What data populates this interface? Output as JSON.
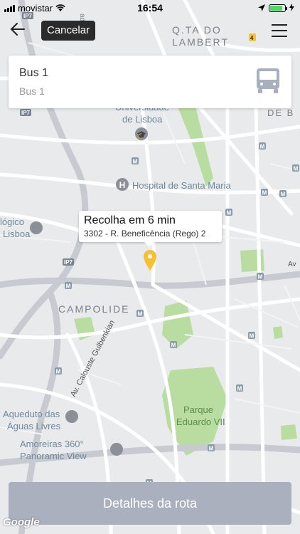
{
  "status": {
    "carrier": "movistar",
    "time": "16:54",
    "battery_fill": 0.85,
    "battery_color": "#4cd964"
  },
  "toolbar": {
    "back_icon": "arrow-left-icon",
    "cancel_label": "Cancelar",
    "menu_icon": "hamburger-menu-icon"
  },
  "bus_card": {
    "title": "Bus 1",
    "subtitle": "Bus 1",
    "icon": "bus-icon"
  },
  "pickup": {
    "title": "Recolha em 6 min",
    "address": "3302 - R. Beneficência (Rego) 2",
    "pin_color": "#f6c131"
  },
  "map": {
    "labels": {
      "qta_lambert_1": "Q.TA DO",
      "qta_lambert_2": "LAMBERT",
      "universidade_1": "Universidade",
      "universidade_2": "de Lisboa",
      "hospital": "Hospital de Santa Maria",
      "logico_1": "lógico",
      "logico_2": "Lisboa",
      "campolide": "CAMPOLIDE",
      "av_calouste": "Av. Calouste Gulbenkian",
      "aqueduto_1": "Aqueduto das",
      "aqueduto_2": "Águas Livres",
      "amoreiras_1": "Amoreiras 360°",
      "amoreiras_2": "Panoramic View",
      "parque_1": "Parque",
      "parque_2": "Eduardo VII",
      "de_b": "DE B",
      "av_right": "Av",
      "ip7_a": "IP7",
      "ip7_b": "IP7",
      "ip7_c": "IP7",
      "ade": "ade",
      "route_4": "4"
    },
    "park_color": "#b9dda0",
    "road_color": "#ffffff",
    "land_color": "#e9eaec"
  },
  "footer": {
    "route_details_label": "Detalhes da rota",
    "google": "Google"
  }
}
